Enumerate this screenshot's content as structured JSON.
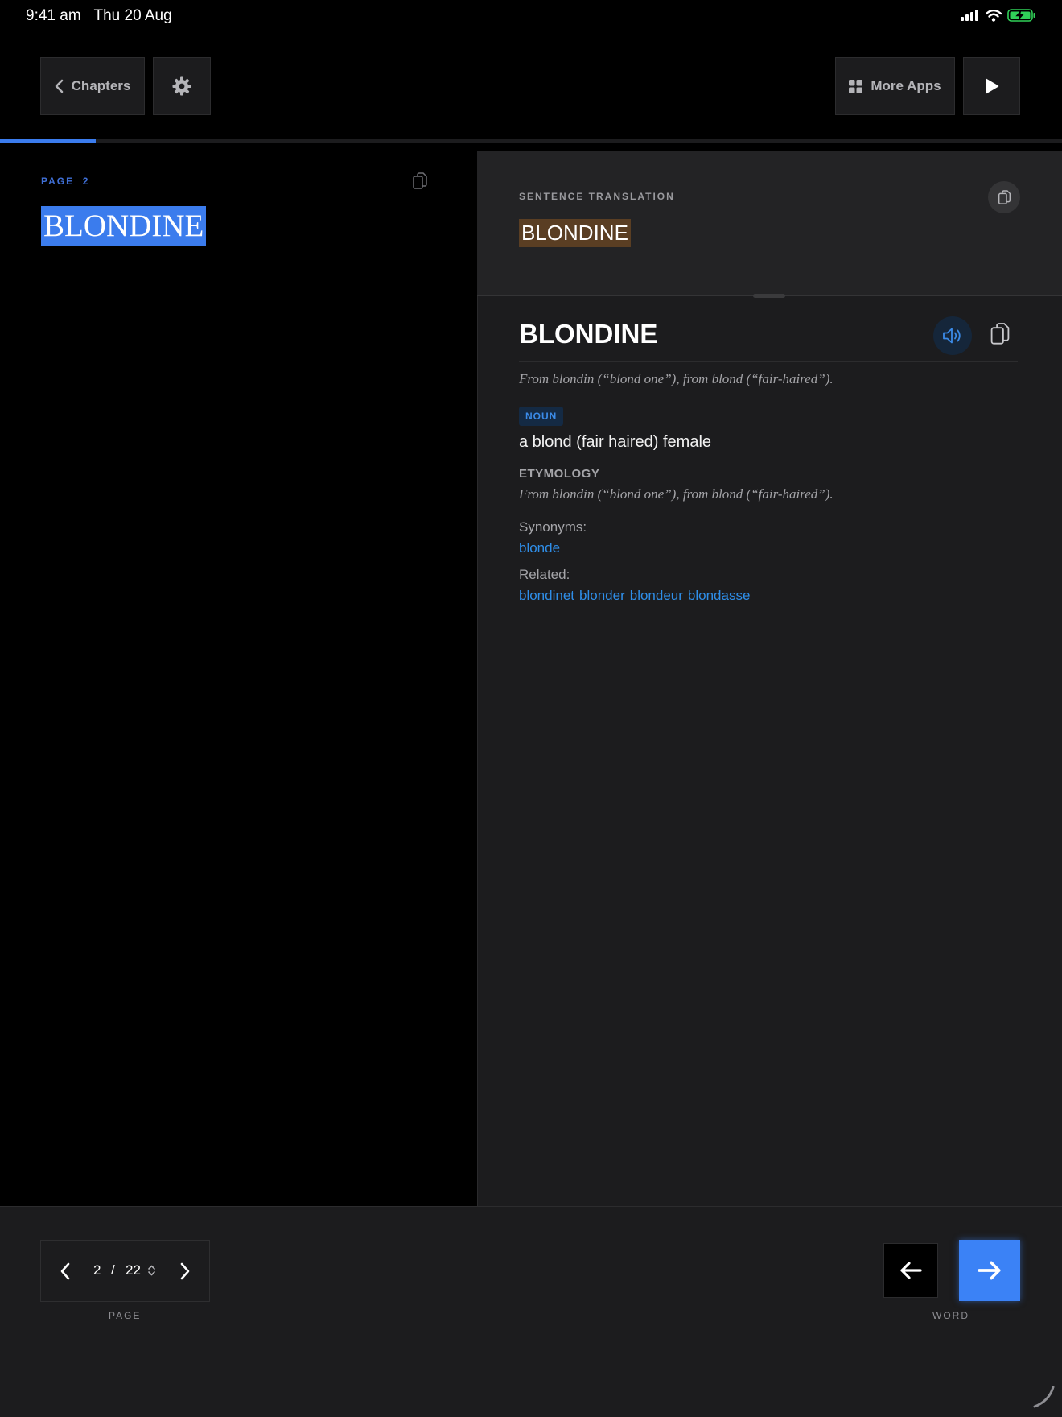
{
  "status_bar": {
    "time": "9:41 am",
    "date": "Thu 20 Aug"
  },
  "toolbar": {
    "chapters_label": "Chapters",
    "more_apps_label": "More Apps"
  },
  "reading_progress": 0.09,
  "page_pane": {
    "page_label": "PAGE",
    "page_number": "2",
    "text": "BLONDINE"
  },
  "translation": {
    "label": "SENTENCE TRANSLATION",
    "text": "BLONDINE"
  },
  "dictionary": {
    "headword": "BLONDINE",
    "origin": "From blondin (“blond one”), from blond (“fair-haired”).",
    "part_of_speech": "NOUN",
    "definition": "a blond (fair haired) female",
    "etymology_heading": "ETYMOLOGY",
    "etymology": "From blondin (“blond one”), from blond (“fair-haired”).",
    "synonyms_label": "Synonyms:",
    "synonyms": [
      "blonde"
    ],
    "related_label": "Related:",
    "related": [
      "blondinet",
      "blonder",
      "blondeur",
      "blondasse"
    ]
  },
  "pager": {
    "current": "2",
    "separator": "/",
    "total": "22",
    "caption": "PAGE"
  },
  "word_nav": {
    "caption": "WORD"
  },
  "colors": {
    "accent": "#3b82f6",
    "highlight_source": "#3b7ced",
    "highlight_translation": "#5a3e23",
    "link": "#2f8ee8",
    "battery": "#30d158"
  }
}
